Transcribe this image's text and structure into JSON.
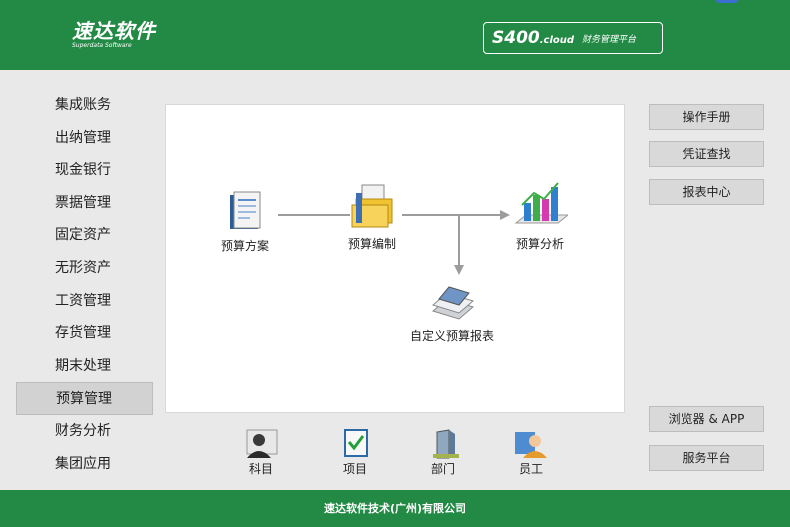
{
  "header": {
    "logo_main": "速达软件",
    "logo_sub": "Superdata Software",
    "product_name": "S400",
    "product_suffix": ".cloud",
    "product_desc": "财务管理平台"
  },
  "sidebar": {
    "items": [
      {
        "label": "集成账务"
      },
      {
        "label": "出纳管理"
      },
      {
        "label": "现金银行"
      },
      {
        "label": "票据管理"
      },
      {
        "label": "固定资产"
      },
      {
        "label": "无形资产"
      },
      {
        "label": "工资管理"
      },
      {
        "label": "存货管理"
      },
      {
        "label": "期末处理"
      },
      {
        "label": "预算管理",
        "active": true
      },
      {
        "label": "财务分析"
      },
      {
        "label": "集团应用"
      }
    ]
  },
  "flow": {
    "plan": "预算方案",
    "compile": "预算编制",
    "analysis": "预算分析",
    "custom_report": "自定义预算报表"
  },
  "bottom": {
    "account": "科目",
    "project": "项目",
    "department": "部门",
    "employee": "员工"
  },
  "right": {
    "manual": "操作手册",
    "voucher": "凭证查找",
    "report": "报表中心",
    "browser": "浏览器 & APP",
    "service": "服务平台"
  },
  "footer": {
    "company": "速达软件技术(广州)有限公司"
  }
}
